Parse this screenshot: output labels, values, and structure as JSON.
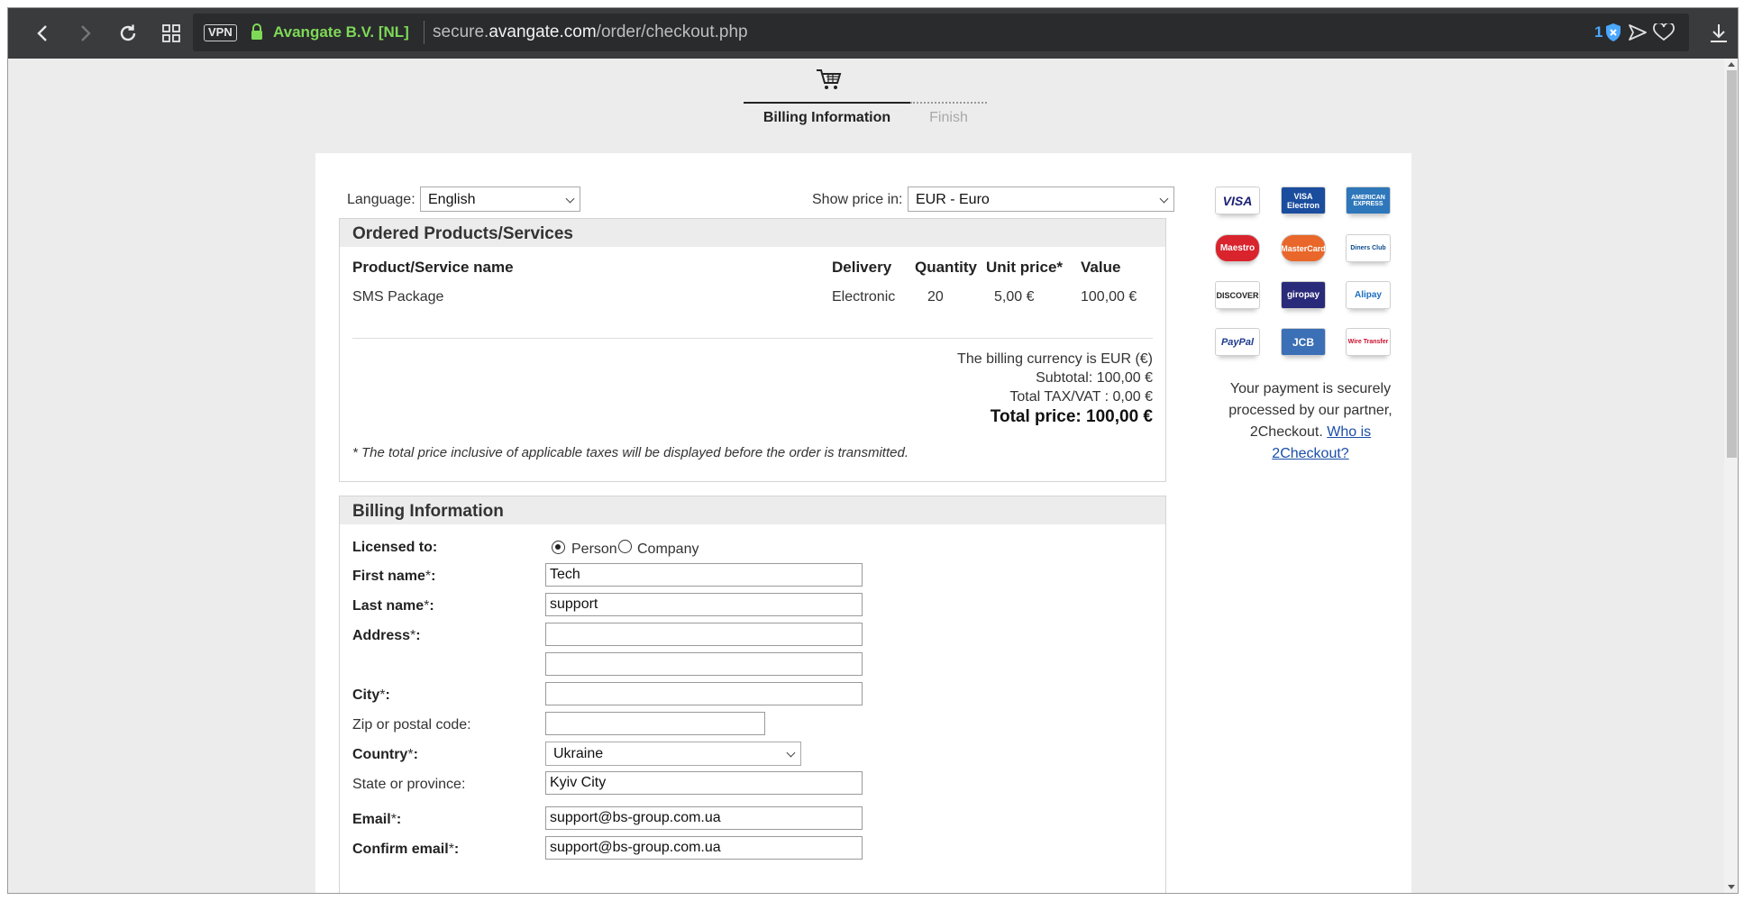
{
  "browser": {
    "vpn_label": "VPN",
    "site_identity": "Avangate B.V. [NL]",
    "url_prefix": "secure.",
    "url_domain": "avangate.com",
    "url_path": "/order/checkout.php",
    "tracker_count": "1"
  },
  "steps": {
    "billing": "Billing Information",
    "finish": "Finish"
  },
  "controls": {
    "language_label": "Language:",
    "language_value": "English",
    "currency_label": "Show price in:",
    "currency_value": "EUR - Euro"
  },
  "products": {
    "title": "Ordered Products/Services",
    "headers": {
      "name": "Product/Service name",
      "delivery": "Delivery",
      "quantity": "Quantity",
      "unit_price": "Unit price*",
      "value": "Value"
    },
    "rows": [
      {
        "name": "SMS Package",
        "delivery": "Electronic",
        "quantity": "20",
        "unit_price": "5,00 €",
        "value": "100,00 €"
      }
    ],
    "billing_currency": "The billing currency is EUR (€)",
    "subtotal": "Subtotal: 100,00 €",
    "tax": "Total TAX/VAT : 0,00 €",
    "total": "Total price: 100,00 €",
    "note": "* The total price inclusive of applicable taxes will be displayed before the order is transmitted."
  },
  "billing": {
    "title": "Billing Information",
    "licensed_to": "Licensed to:",
    "person": "Person",
    "company": "Company",
    "first_name_label": "First name",
    "first_name": "Tech",
    "last_name_label": "Last name",
    "last_name": "support",
    "address_label": "Address",
    "address1": "",
    "address2": "",
    "city_label": "City",
    "city": "",
    "zip_label": "Zip or postal code:",
    "zip": "",
    "country_label": "Country",
    "country": "Ukraine",
    "state_label": "State or province:",
    "state": "Kyiv City",
    "email_label": "Email",
    "email": "support@bs-group.com.ua",
    "confirm_email_label": "Confirm email",
    "confirm_email": "support@bs-group.com.ua",
    "required_mark": "*",
    "colon": ":"
  },
  "payment": {
    "logos": [
      "VISA",
      "VISA Electron",
      "AMERICAN EXPRESS",
      "Maestro",
      "MasterCard",
      "Diners Club",
      "DISCOVER",
      "giropay",
      "Alipay",
      "PayPal",
      "JCB",
      "Wire Transfer"
    ],
    "secure_text": "Your payment is securely processed by our partner, 2Checkout.",
    "who_link": "Who is 2Checkout?"
  },
  "colors": {
    "toolbar": "#3a3b3d",
    "identity_green": "#7ed957",
    "link_blue": "#1a4ea8"
  }
}
